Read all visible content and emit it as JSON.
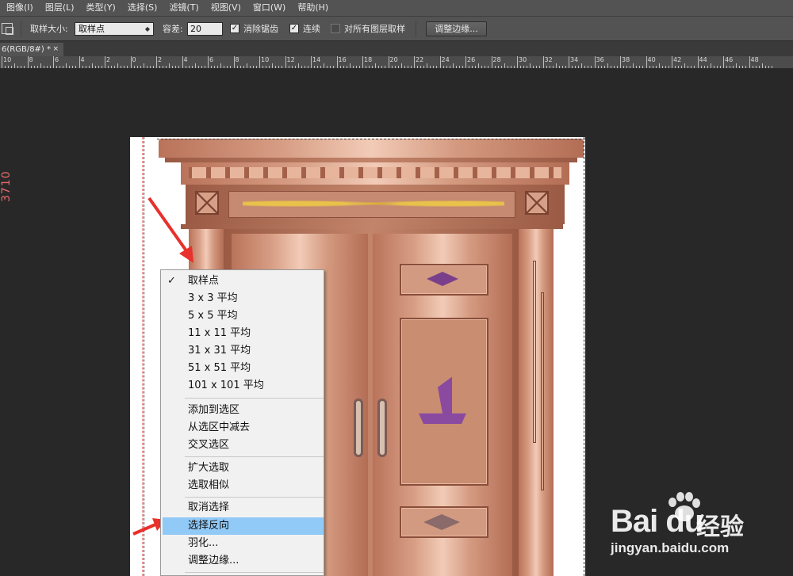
{
  "menubar": {
    "items": [
      "图像(I)",
      "图层(L)",
      "类型(Y)",
      "选择(S)",
      "滤镜(T)",
      "视图(V)",
      "窗口(W)",
      "帮助(H)"
    ]
  },
  "options": {
    "sample_size_label": "取样大小:",
    "sample_size_value": "取样点",
    "tolerance_label": "容差:",
    "tolerance_value": "20",
    "antialias_label": "消除锯齿",
    "antialias_checked": true,
    "contiguous_label": "连续",
    "contiguous_checked": true,
    "all_layers_label": "对所有图层取样",
    "all_layers_checked": false,
    "refine_edge_button": "调整边缘..."
  },
  "document_tab": {
    "title": "6(RGB/8#) *",
    "close_glyph": "×"
  },
  "ruler": {
    "labels": [
      "10",
      "8",
      "6",
      "4",
      "2",
      "0",
      "2",
      "4",
      "6",
      "8",
      "10",
      "12",
      "14",
      "16",
      "18",
      "20",
      "22",
      "24",
      "26",
      "28",
      "30",
      "32",
      "34",
      "36",
      "38",
      "40",
      "42",
      "44",
      "46",
      "48"
    ]
  },
  "canvas": {
    "dimension_text": "3710"
  },
  "context_menu": {
    "items": [
      {
        "label": "取样点",
        "checked": true
      },
      {
        "label": "3 x 3 平均"
      },
      {
        "label": "5 x 5 平均"
      },
      {
        "label": "11 x 11 平均"
      },
      {
        "label": "31 x 31 平均"
      },
      {
        "label": "51 x 51 平均"
      },
      {
        "label": "101 x 101 平均"
      },
      {
        "label": "添加到选区"
      },
      {
        "label": "从选区中减去"
      },
      {
        "label": "交叉选区"
      },
      {
        "label": "扩大选取"
      },
      {
        "label": "选取相似"
      },
      {
        "label": "取消选择"
      },
      {
        "label": "选择反向",
        "highlighted": true
      },
      {
        "label": "羽化..."
      },
      {
        "label": "调整边缘..."
      }
    ],
    "check_glyph": "✓"
  },
  "watermark": {
    "logo_text": "Bai du",
    "jingyan_text": "经验",
    "url": "jingyan.baidu.com"
  },
  "colors": {
    "menubar_bg": "#535353",
    "workspace_bg": "#282828",
    "menu_highlight": "#91c9f7",
    "annotation_arrow": "#e8302c",
    "copper": "#d89f86"
  }
}
